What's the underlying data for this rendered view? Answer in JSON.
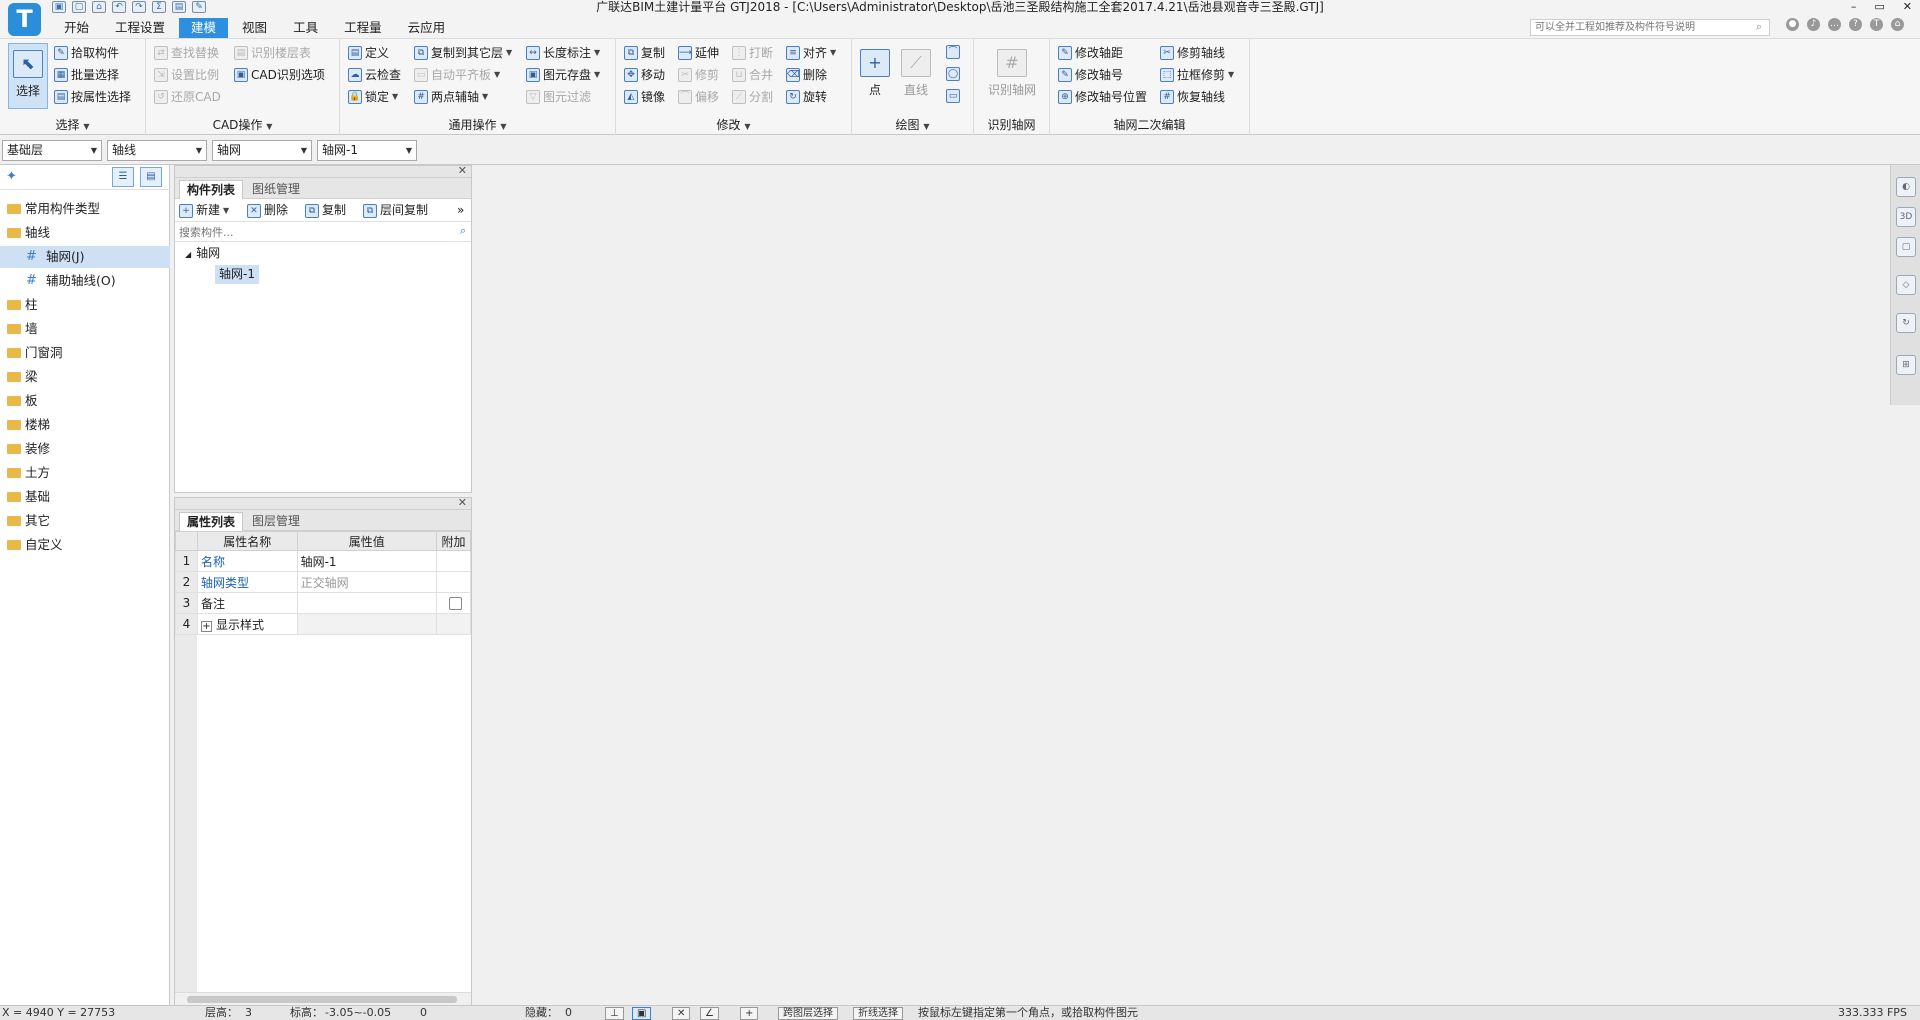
{
  "app": {
    "logo": "T",
    "window_title": "广联达BIM土建计量平台 GTJ2018 - [C:\\Users\\Administrator\\Desktop\\岳池三圣殿结构施工全套2017.4.21\\岳池县观音寺三圣殿.GTJ]",
    "search_placeholder": "可以全并工程如推荐及构件符号说明",
    "window_controls": [
      "–",
      "▭",
      "✕"
    ]
  },
  "menu": {
    "tabs": [
      "开始",
      "工程设置",
      "建模",
      "视图",
      "工具",
      "工程量",
      "云应用"
    ],
    "active_index": 2
  },
  "ribbon": {
    "select": {
      "label": "选择",
      "big_button": "选择",
      "items": [
        "拾取构件",
        "批量选择",
        "按属性选择"
      ]
    },
    "cad": {
      "label": "CAD操作",
      "items": [
        "查找替换",
        "识别楼层表",
        "设置比例",
        "CAD识别选项",
        "还原CAD"
      ]
    },
    "common": {
      "label": "通用操作",
      "items": [
        "定义",
        "复制到其它层",
        "长度标注",
        "云检查",
        "自动平齐板",
        "图元存盘",
        "锁定",
        "两点辅轴",
        "图元过滤"
      ]
    },
    "modify": {
      "label": "修改",
      "items": [
        "复制",
        "延伸",
        "打断",
        "对齐",
        "移动",
        "修剪",
        "合并",
        "删除",
        "镜像",
        "偏移",
        "分割",
        "旋转"
      ]
    },
    "draw": {
      "label": "绘图",
      "items": [
        "点",
        "直线"
      ]
    },
    "recognize": {
      "label": "识别轴网",
      "big_button": "识别轴网"
    },
    "axis_edit": {
      "label": "轴网二次编辑",
      "items": [
        "修改轴距",
        "修剪轴线",
        "修改轴号",
        "拉框修剪",
        "修改轴号位置",
        "恢复轴线"
      ]
    }
  },
  "selectors": [
    "基础层",
    "轴线",
    "轴网",
    "轴网-1"
  ],
  "leftnav": {
    "items": [
      {
        "label": "常用构件类型",
        "type": "folder"
      },
      {
        "label": "轴线",
        "type": "folder-open"
      },
      {
        "label": "轴网(J)",
        "type": "sub"
      },
      {
        "label": "辅助轴线(O)",
        "type": "sub"
      },
      {
        "label": "柱",
        "type": "folder"
      },
      {
        "label": "墙",
        "type": "folder"
      },
      {
        "label": "门窗洞",
        "type": "folder"
      },
      {
        "label": "梁",
        "type": "folder"
      },
      {
        "label": "板",
        "type": "folder"
      },
      {
        "label": "楼梯",
        "type": "folder"
      },
      {
        "label": "装修",
        "type": "folder"
      },
      {
        "label": "土方",
        "type": "folder"
      },
      {
        "label": "基础",
        "type": "folder"
      },
      {
        "label": "其它",
        "type": "folder"
      },
      {
        "label": "自定义",
        "type": "folder"
      }
    ],
    "selected_index": 2
  },
  "complist": {
    "tabs": [
      "构件列表",
      "图纸管理"
    ],
    "toolbar": [
      "新建",
      "删除",
      "复制",
      "层间复制"
    ],
    "search_placeholder": "搜索构件...",
    "tree_root": "轴网",
    "tree_leaf": "轴网-1"
  },
  "proppanel": {
    "tabs": [
      "属性列表",
      "图层管理"
    ],
    "columns": [
      "属性名称",
      "属性值",
      "附加"
    ],
    "rows": [
      {
        "n": "1",
        "name": "名称",
        "value": "轴网-1"
      },
      {
        "n": "2",
        "name": "轴网类型",
        "value": "正交轴网"
      },
      {
        "n": "3",
        "name": "备注",
        "value": ""
      },
      {
        "n": "4",
        "name": "显示样式",
        "value": ""
      }
    ]
  },
  "status": {
    "coords": "X = 4940 Y = 27753",
    "floor_height_label": "层高：",
    "floor_height": "3",
    "elevation_label": "标高：",
    "elevation": "-3.05~-0.05",
    "zero": "0",
    "hidden_label": "隐藏：",
    "hidden": "0",
    "btn_cross_layer": "跨图层选择",
    "btn_polyline": "折线选择",
    "hint": "按鼠标左键指定第一个角点，或拾取构件图元",
    "fps": "333.333 FPS"
  }
}
